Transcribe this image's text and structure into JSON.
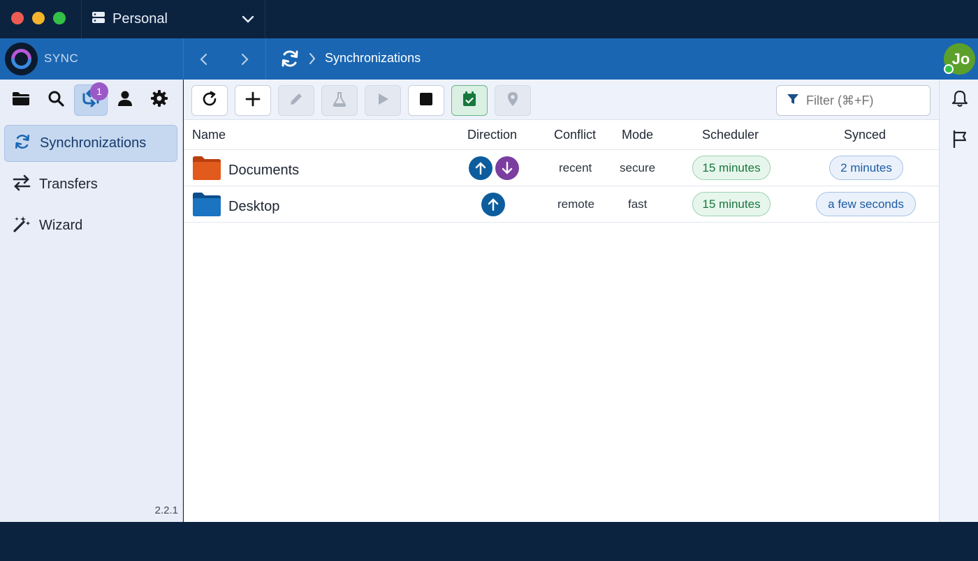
{
  "window": {
    "profile": {
      "label": "Personal",
      "icon": "server-icon"
    }
  },
  "header": {
    "app_label": "SYNC",
    "breadcrumb": {
      "icon": "sync-icon",
      "title": "Synchronizations"
    },
    "avatar": {
      "initials": "Jo",
      "color": "#5ca02c",
      "status_color": "#32c146"
    }
  },
  "sidebar": {
    "icons": [
      {
        "name": "folder-icon"
      },
      {
        "name": "search-icon"
      },
      {
        "name": "sync-icon",
        "active": true,
        "badge": "1"
      },
      {
        "name": "user-icon"
      },
      {
        "name": "gear-icon"
      }
    ],
    "items": [
      {
        "label": "Synchronizations",
        "icon": "sync-icon",
        "active": true
      },
      {
        "label": "Transfers",
        "icon": "transfer-icon",
        "active": false
      },
      {
        "label": "Wizard",
        "icon": "magic-wand-icon",
        "active": false
      }
    ],
    "version": "2.2.1"
  },
  "toolbar": {
    "buttons": [
      {
        "name": "refresh-button",
        "icon": "refresh-icon",
        "enabled": true
      },
      {
        "name": "add-button",
        "icon": "plus-icon",
        "enabled": true
      },
      {
        "name": "edit-button",
        "icon": "pencil-icon",
        "enabled": false
      },
      {
        "name": "test-button",
        "icon": "flask-icon",
        "enabled": false
      },
      {
        "name": "start-button",
        "icon": "play-icon",
        "enabled": false
      },
      {
        "name": "stop-button",
        "icon": "stop-icon",
        "enabled": true
      },
      {
        "name": "scheduler-button",
        "icon": "calendar-check-icon",
        "enabled": true,
        "toggled": true
      },
      {
        "name": "locate-button",
        "icon": "map-pin-icon",
        "enabled": false
      }
    ],
    "filter": {
      "placeholder": "Filter (⌘+F)",
      "value": ""
    }
  },
  "table": {
    "columns": [
      "Name",
      "Direction",
      "Conflict",
      "Mode",
      "Scheduler",
      "Synced"
    ],
    "rows": [
      {
        "name": "Documents",
        "folder_color": "#d9531e",
        "direction": [
          "upload",
          "download"
        ],
        "conflict": "recent",
        "mode": "secure",
        "scheduler": "15 minutes",
        "synced": "2 minutes"
      },
      {
        "name": "Desktop",
        "folder_color": "#1469b4",
        "direction": [
          "upload"
        ],
        "conflict": "remote",
        "mode": "fast",
        "scheduler": "15 minutes",
        "synced": "a few seconds"
      }
    ]
  },
  "rail": {
    "icons": [
      "bell-icon",
      "flag-icon"
    ]
  },
  "colors": {
    "header": "#1a66b2",
    "chrome": "#0c2340",
    "upload": "#0d5d9e",
    "download": "#7b3ea0"
  }
}
